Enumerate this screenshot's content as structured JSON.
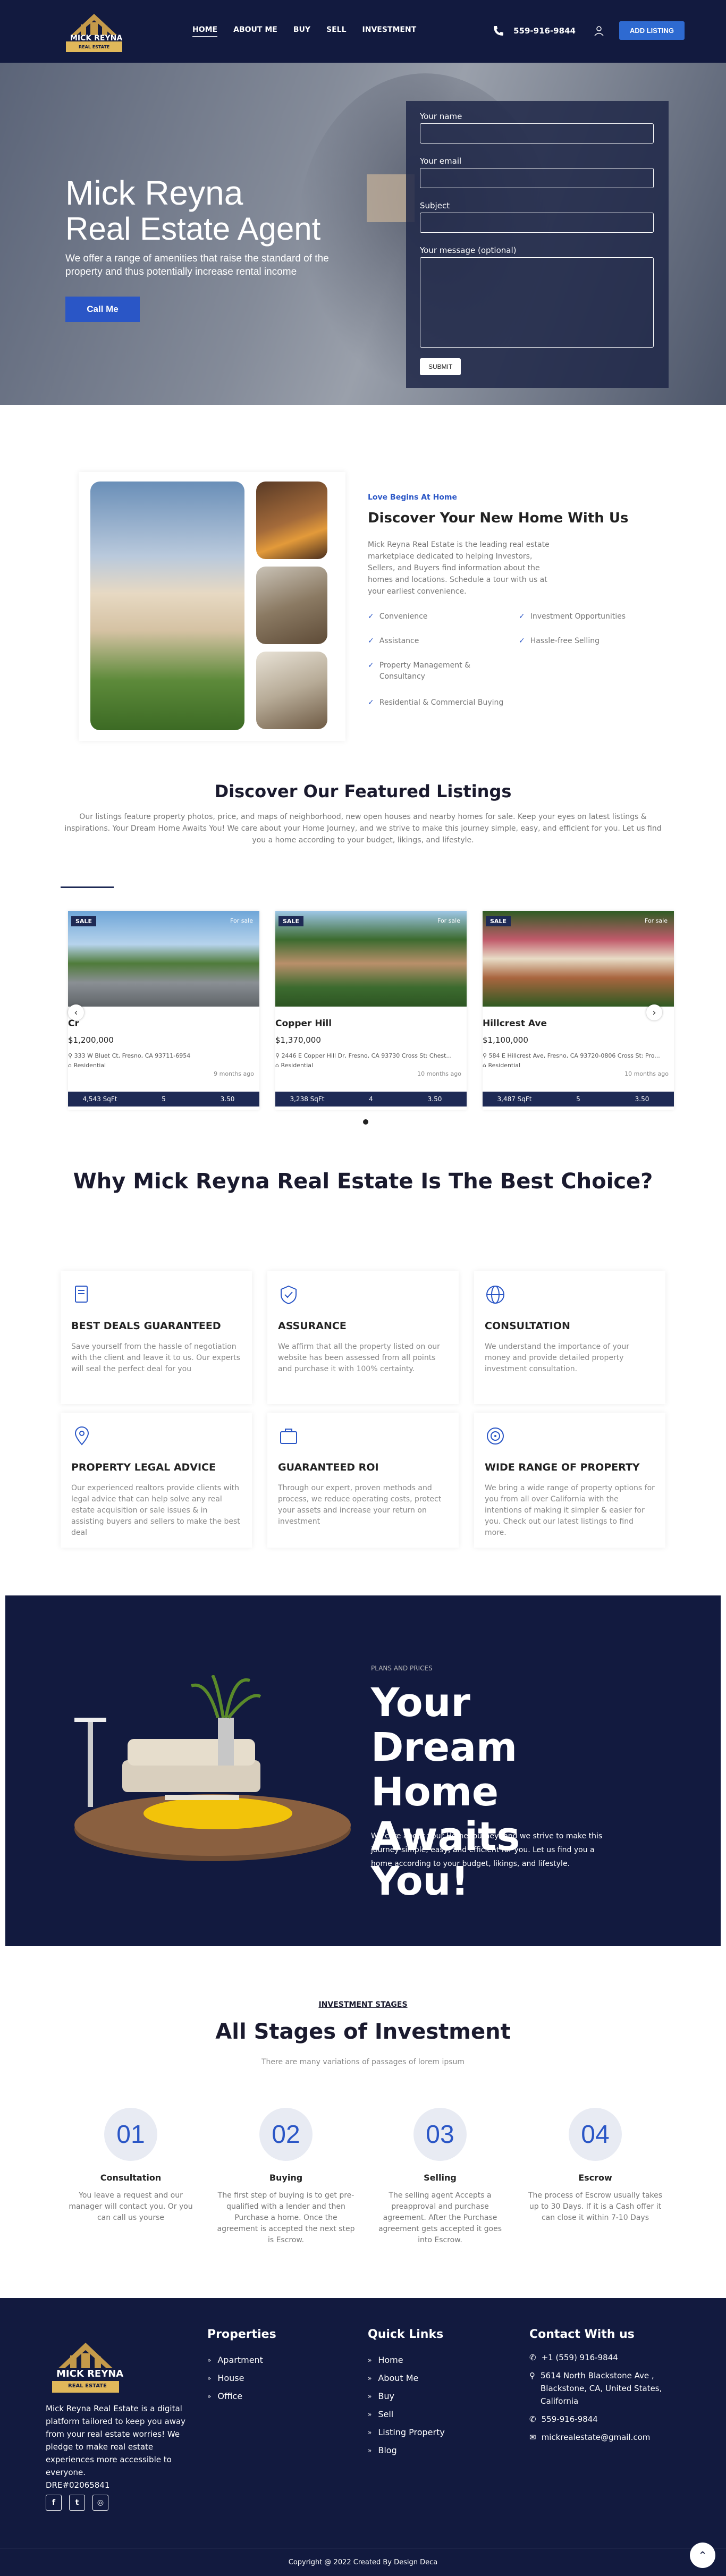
{
  "header": {
    "logo_text": "MICK REYNA",
    "logo_sub": "REAL ESTATE",
    "nav": [
      "HOME",
      "ABOUT ME",
      "BUY",
      "SELL",
      "INVESTMENT"
    ],
    "phone": "559-916-9844",
    "add_listing": "ADD LISTING"
  },
  "hero": {
    "title1": "Mick Reyna",
    "title2": "Real Estate Agent",
    "subtitle": "We offer a range of amenities that raise the standard of the property and thus potentially increase rental income",
    "cta": "Call Me",
    "form": {
      "name_label": "Your name",
      "email_label": "Your email",
      "subject_label": "Subject",
      "message_label": "Your message (optional)",
      "submit": "SUBMIT"
    }
  },
  "about": {
    "tag": "Love Begins At Home",
    "title": "Discover Your New Home With Us",
    "text": "Mick Reyna Real Estate is the leading real estate marketplace dedicated to helping Investors, Sellers, and Buyers find information about the homes and locations. Schedule a tour with us at your earliest convenience.",
    "features_left": [
      "Convenience",
      "Assistance",
      "Property Management & Consultancy",
      "Residential & Commercial Buying"
    ],
    "features_right": [
      "Investment Opportunities",
      "Hassle-free Selling"
    ]
  },
  "listings": {
    "title": "Discover Our Featured Listings",
    "text": "Our listings feature property photos, price, and maps of neighborhood, new open houses and nearby homes for sale. Keep your eyes on latest listings & inspirations. Your Dream Home Awaits You! We care about your Home Journey, and we strive to make this journey simple, easy, and efficient for you. Let us find you a home according to your budget, likings, and lifestyle.",
    "sale_badge": "SALE",
    "for_sale": "For sale",
    "cards": [
      {
        "name": "Cr",
        "price": "$1,200,000",
        "address": "333 W Bluet Ct, Fresno, CA 93711-6954",
        "type": "Residential",
        "age": "9 months ago",
        "sqft": "4,543 SqFt",
        "beds": "5",
        "baths": "3.50"
      },
      {
        "name": "Copper Hill",
        "price": "$1,370,000",
        "address": "2446 E Copper Hill Dr, Fresno, CA 93730 Cross St: Chest...",
        "type": "Residential",
        "age": "10 months ago",
        "sqft": "3,238 SqFt",
        "beds": "4",
        "baths": "3.50"
      },
      {
        "name": "Hillcrest Ave",
        "price": "$1,100,000",
        "address": "584 E Hillcrest Ave, Fresno, CA 93720-0806 Cross St: Pro...",
        "type": "Residential",
        "age": "10 months ago",
        "sqft": "3,487 SqFt",
        "beds": "5",
        "baths": "3.50"
      }
    ]
  },
  "why": {
    "title": "Why Mick Reyna Real Estate Is The Best Choice?",
    "cards": [
      {
        "title": "BEST DEALS GUARANTEED",
        "text": "Save yourself from the hassle of negotiation with the client and leave it to us. Our experts will seal the perfect deal for you"
      },
      {
        "title": "ASSURANCE",
        "text": "We affirm that all the property listed on our website has been assessed from all points and purchase it with 100% certainty."
      },
      {
        "title": "CONSULTATION",
        "text": "We understand the importance of your money and provide detailed property investment consultation."
      },
      {
        "title": "PROPERTY LEGAL ADVICE",
        "text": "Our experienced realtors provide clients with legal advice that can help solve any real estate acquisition or sale issues & in assisting buyers and sellers to make the best deal"
      },
      {
        "title": "GUARANTEED ROI",
        "text": "Through our expert, proven methods and process, we reduce operating costs, protect your assets and increase your return on investment"
      },
      {
        "title": "WIDE RANGE OF PROPERTY",
        "text": "We bring a wide range of property options for you from all over California with the intentions of making it simpler & easier for you. Check out our latest listings to find more."
      }
    ]
  },
  "dream": {
    "tag": "PLANS AND PRICES",
    "title": "Your Dream Home Awaits You!",
    "text": "We care about your Home Journey, and we strive to make this journey simple, easy, and efficient for you. Let us find you a home according to your budget, likings, and lifestyle."
  },
  "stages": {
    "tag": "INVESTMENT STAGES",
    "title": "All Stages of Investment",
    "sub": "There are many variations of passages of lorem ipsum",
    "items": [
      {
        "num": "01",
        "title": "Consultation",
        "text": "You leave a request and our manager will contact you. Or you can call us yourse"
      },
      {
        "num": "02",
        "title": "Buying",
        "text": "The first step of buying is to get pre-qualified with a lender and then Purchase a home. Once the agreement is accepted the next step is Escrow."
      },
      {
        "num": "03",
        "title": "Selling",
        "text": "The selling agent Accepts a preapproval and purchase agreement. After the Purchase agreement gets accepted it goes into Escrow."
      },
      {
        "num": "04",
        "title": "Escrow",
        "text": "The process of Escrow usually takes up to 30 Days. If it is a Cash offer it can close it within 7-10 Days"
      }
    ]
  },
  "footer": {
    "about": "Mick Reyna Real Estate is a digital platform tailored to keep you away from your real estate worries! We pledge to make real estate experiences more accessible to everyone.",
    "dre": "DRE#02065841",
    "properties_title": "Properties",
    "properties": [
      "Apartment",
      "House",
      "Office"
    ],
    "links_title": "Quick Links",
    "links": [
      "Home",
      "About Me",
      "Buy",
      "Sell",
      "Listing Property",
      "Blog"
    ],
    "contact_title": "Contact With us",
    "contact_phone1": "+1 (559) 916-9844",
    "contact_address": "5614 North Blackstone Ave , Blackstone, CA, United States, California",
    "contact_phone2": "559-916-9844",
    "contact_email": "mickrealestate@gmail.com",
    "copyright": "Copyright @ 2022 Created By Design Deca"
  }
}
